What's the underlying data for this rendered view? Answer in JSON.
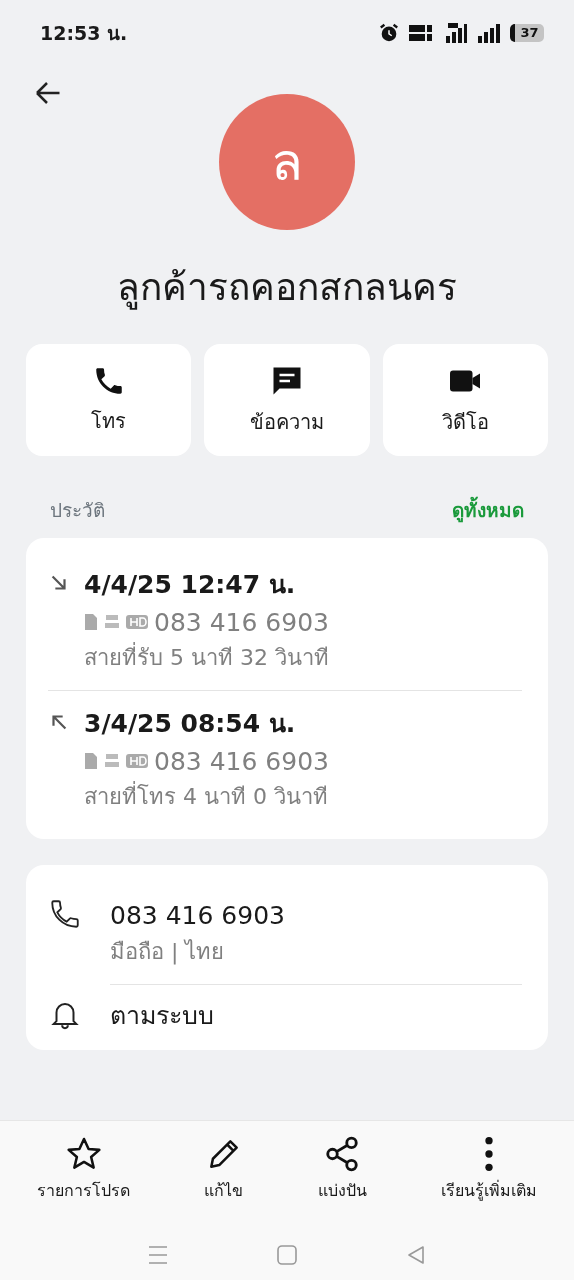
{
  "status_bar": {
    "time": "12:53 น.",
    "battery": "37"
  },
  "contact": {
    "initial": "ล",
    "name": "ลูกค้ารถคอกสกลนคร"
  },
  "actions": [
    {
      "kind": "call",
      "label": "โทร"
    },
    {
      "kind": "message",
      "label": "ข้อความ"
    },
    {
      "kind": "video",
      "label": "วิดีโอ"
    }
  ],
  "history": {
    "title": "ประวัติ",
    "see_all": "ดูทั้งหมด",
    "calls": [
      {
        "kind": "incoming",
        "datetime": "4/4/25 12:47 น.",
        "number": "083 416 6903",
        "detail": "สายที่รับ  5 นาที 32 วินาที"
      },
      {
        "kind": "outgoing",
        "datetime": "3/4/25 08:54 น.",
        "number": "083 416 6903",
        "detail": "สายที่โทร  4 นาที 0 วินาที"
      }
    ]
  },
  "details": [
    {
      "kind": "phone",
      "title": "083 416 6903",
      "subtitle": "มือถือ  |  ไทย"
    },
    {
      "kind": "ringtone",
      "title": "ตามระบบ"
    }
  ],
  "bottom_actions": [
    {
      "kind": "favorite",
      "label": "รายการโปรด"
    },
    {
      "kind": "edit",
      "label": "แก้ไข"
    },
    {
      "kind": "share",
      "label": "แบ่งปัน"
    },
    {
      "kind": "more",
      "label": "เรียนรู้เพิ่มเติม"
    }
  ]
}
